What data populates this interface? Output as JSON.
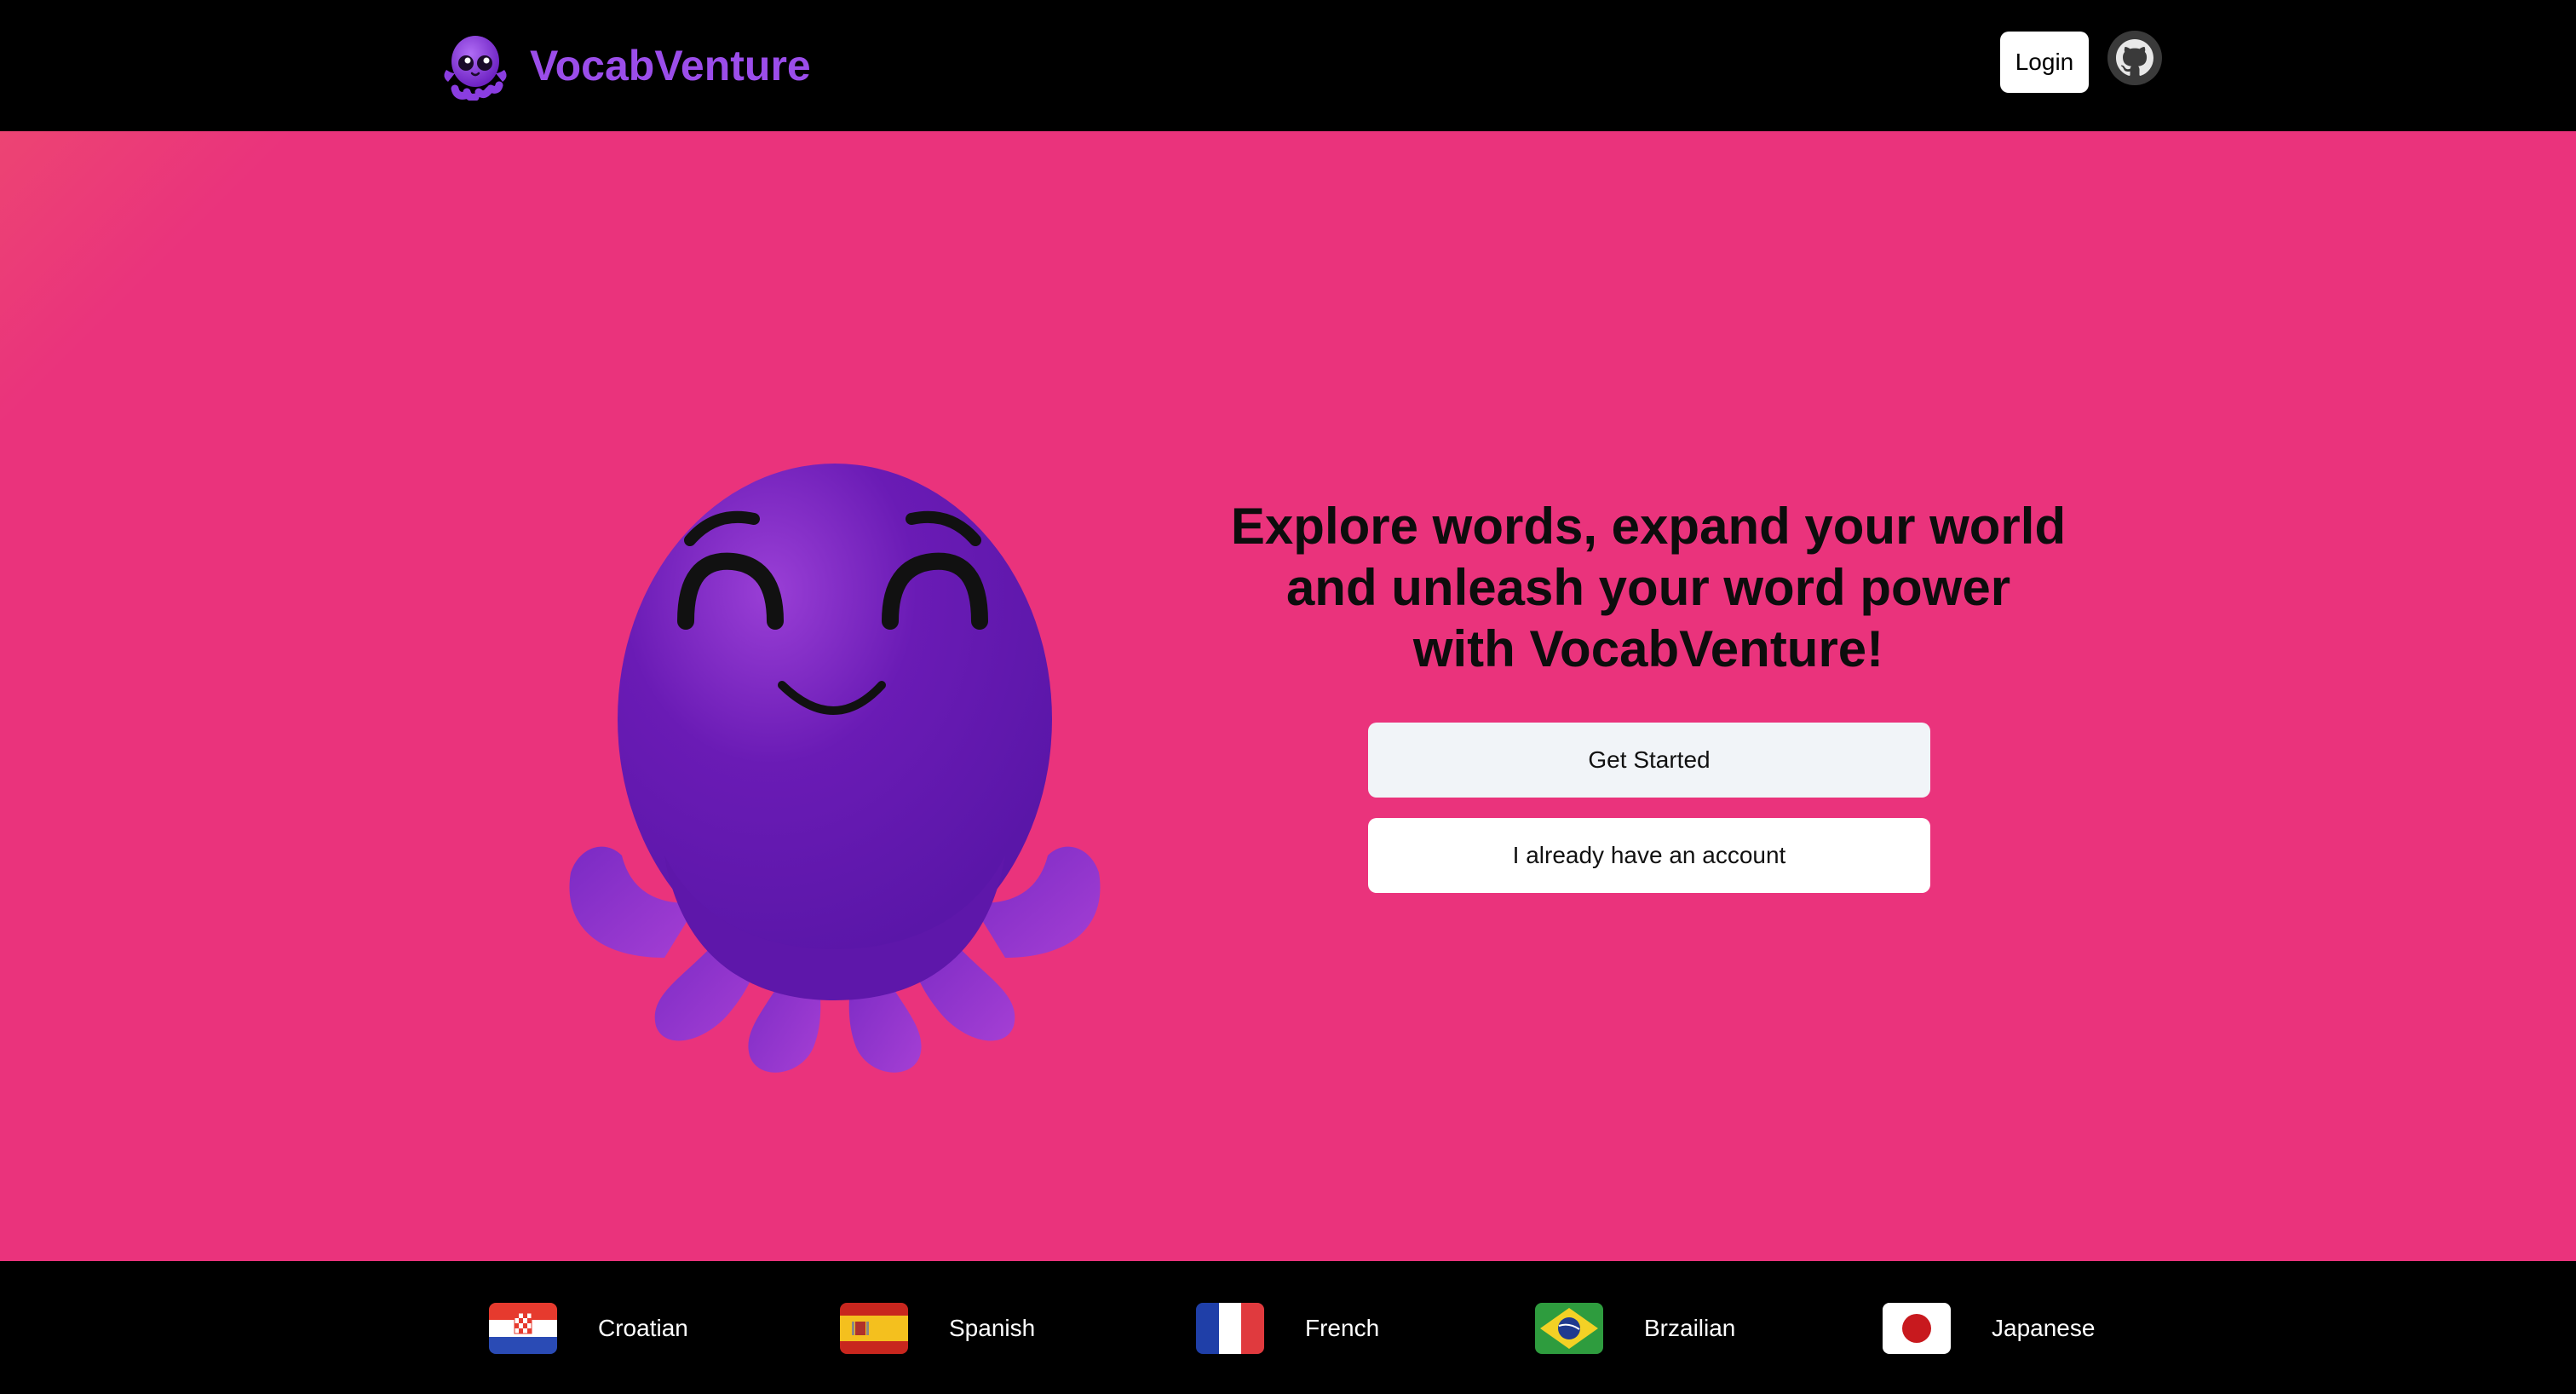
{
  "header": {
    "brand": "VocabVenture",
    "login_label": "Login",
    "logo_icon": "octopus-logo-icon",
    "github_icon": "github-icon"
  },
  "hero": {
    "headline_lines": [
      "Explore words, expand your world",
      "and unleash your word power",
      "with VocabVenture!"
    ],
    "get_started_label": "Get Started",
    "have_account_label": "I already have an account",
    "mascot_icon": "octopus-mascot-icon"
  },
  "footer": {
    "languages": [
      {
        "label": "Croatian",
        "flag": "croatia-flag-icon"
      },
      {
        "label": "Spanish",
        "flag": "spain-flag-icon"
      },
      {
        "label": "French",
        "flag": "france-flag-icon"
      },
      {
        "label": "Brzailian",
        "flag": "brazil-flag-icon"
      },
      {
        "label": "Japanese",
        "flag": "japan-flag-icon"
      }
    ]
  },
  "colors": {
    "brand": "#9b4dea",
    "hero_background": "#ea337c",
    "header_background": "#000000",
    "octopus": "#6a1bb5"
  }
}
